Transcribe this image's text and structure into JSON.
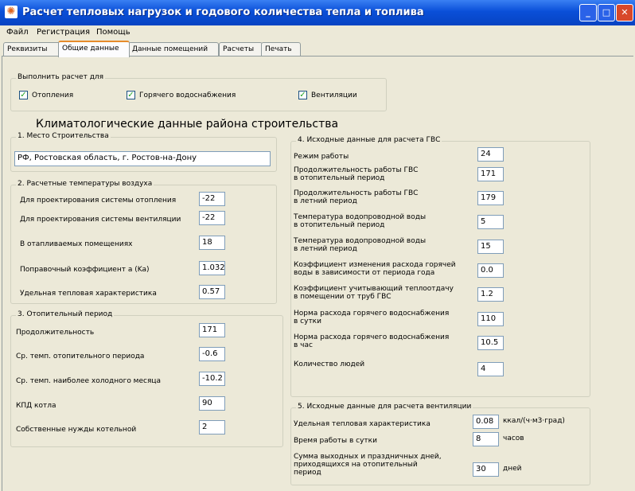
{
  "window": {
    "title": "Расчет тепловых нагрузок и годового количества тепла и топлива"
  },
  "menu": [
    "Файл",
    "Регистрация",
    "Помощь"
  ],
  "tabs": [
    "Реквизиты",
    "Общие данные",
    "Данные помещений",
    "Расчеты",
    "Печать"
  ],
  "active_tab": "Общие данные",
  "perform": {
    "label": "Выполнить расчет для",
    "options": [
      {
        "label": "Отопления",
        "checked": true
      },
      {
        "label": "Горячего водоснабжения",
        "checked": true
      },
      {
        "label": "Вентиляции",
        "checked": true
      }
    ]
  },
  "climate_title": "Климатологические данные района строительства",
  "location": {
    "label": "1. Место Строительства",
    "value": "РФ, Ростовская область, г. Ростов-на-Дону"
  },
  "temps": {
    "label": "2. Расчетные температуры воздуха",
    "rows": [
      {
        "label": "Для проектирования системы отопления",
        "value": "-22"
      },
      {
        "label": "Для проектирования системы вентиляции",
        "value": "-22"
      },
      {
        "label": "В отапливаемых помещениях",
        "value": "18"
      },
      {
        "label": "Поправочный коэффициент a (Ka)",
        "value": "1.032"
      },
      {
        "label": "Удельная тепловая характеристика",
        "value": "0.57"
      }
    ]
  },
  "heating": {
    "label": "3. Отопительный период",
    "rows": [
      {
        "label": "Продолжительность",
        "value": "171"
      },
      {
        "label": "Ср. темп. отопительного периода",
        "value": "-0.6"
      },
      {
        "label": "Ср. темп. наиболее холодного месяца",
        "value": "-10.2"
      },
      {
        "label": "КПД котла",
        "value": "90"
      },
      {
        "label": "Собственные нужды котельной",
        "value": "2"
      }
    ]
  },
  "gvs": {
    "label": "4. Исходные данные для расчета ГВС",
    "rows": [
      {
        "label": "Режим работы",
        "value": "24"
      },
      {
        "label": "Продолжительность работы ГВС\nв отопительный период",
        "value": "171"
      },
      {
        "label": "Продолжительность работы ГВС\nв летний период",
        "value": "179"
      },
      {
        "label": "Температура водопроводной воды\nв отопительный период",
        "value": "5"
      },
      {
        "label": "Температура водопроводной воды\nв летний период",
        "value": "15"
      },
      {
        "label": "Коэффициент изменения расхода горячей\nводы в зависимости от периода года",
        "value": "0.0"
      },
      {
        "label": "Коэффициент учитывающий теплоотдачу\nв помещении от труб ГВС",
        "value": "1.2"
      },
      {
        "label": "Норма расхода горячего водоснабжения\nв сутки",
        "value": "110"
      },
      {
        "label": "Норма расхода горячего водоснабжения\nв час",
        "value": "10.5"
      },
      {
        "label": "Количество людей",
        "value": "4"
      }
    ]
  },
  "vent": {
    "label": "5. Исходные данные для расчета вентиляции",
    "rows": [
      {
        "label": "Удельная тепловая характеристика",
        "value": "0.08",
        "unit": "ккал/(ч·м3·град)"
      },
      {
        "label": "Время работы в сутки",
        "value": "8",
        "unit": "часов"
      },
      {
        "label": "Сумма выходных и праздничных дней,\nприходящихся на отопительный\nпериод",
        "value": "30",
        "unit": "дней"
      }
    ]
  }
}
